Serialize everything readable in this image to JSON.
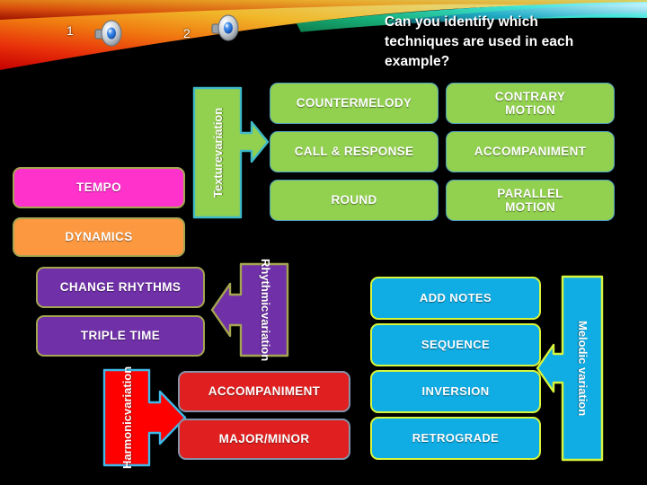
{
  "header": {
    "question": "Can you identify which techniques are used in each example?",
    "question_lines": [
      "Can you identify which",
      "techniques are used in each",
      "example?"
    ],
    "audio_clips": [
      {
        "number": "1",
        "icon": "speaker-icon"
      },
      {
        "number": "2",
        "icon": "speaker-icon"
      }
    ]
  },
  "colors": {
    "green": "#92d14f",
    "pink": "#ff33cc",
    "orange": "#fb9840",
    "purple": "#7030a8",
    "red": "#e02020",
    "cyan": "#10ade4",
    "green_border": "#4f9dc0",
    "olive_border": "#a5a551",
    "yellow_border": "#d8f53c",
    "red_border": "#8592a8",
    "background": "#000000",
    "text": "#ffffff"
  },
  "categories": {
    "texture": {
      "label": "Texture variation",
      "label_lines": [
        "Texture",
        "variation"
      ],
      "arrow_direction": "right",
      "color": "#92d14f",
      "items": [
        "COUNTERMELODY",
        "CONTRARY MOTION",
        "CALL & RESPONSE",
        "ACCOMPANIMENT",
        "ROUND",
        "PARALLEL MOTION"
      ]
    },
    "rhythmic": {
      "label": "Rhythmic variation",
      "label_lines": [
        "Rhythmic",
        "variation"
      ],
      "arrow_direction": "left",
      "color": "#7030a8",
      "items": [
        "CHANGE RHYTHMS",
        "TRIPLE TIME"
      ]
    },
    "harmonic": {
      "label": "Harmonic variation",
      "label_lines": [
        "Harmonic",
        "variation"
      ],
      "arrow_direction": "right",
      "color": "#e02020",
      "items": [
        "ACCOMPANIMENT",
        "MAJOR/MINOR"
      ]
    },
    "melodic": {
      "label": "Melodic variation",
      "label_lines": [
        "Melodic variation"
      ],
      "arrow_direction": "left",
      "color": "#10ade4",
      "items": [
        "ADD NOTES",
        "SEQUENCE",
        "INVERSION",
        "RETROGRADE"
      ]
    }
  },
  "standalone": {
    "tempo": "TEMPO",
    "dynamics": "DYNAMICS"
  },
  "texture_grid": {
    "col1": [
      "COUNTERMELODY",
      "CALL & RESPONSE",
      "ROUND"
    ],
    "col2": [
      "CONTRARY MOTION",
      "ACCOMPANIMENT",
      "PARALLEL MOTION"
    ]
  },
  "texture_col2_lines": {
    "r0": [
      "CONTRARY",
      "MOTION"
    ],
    "r1": [
      "ACCOMPANIMENT"
    ],
    "r2": [
      "PARALLEL",
      "MOTION"
    ]
  }
}
